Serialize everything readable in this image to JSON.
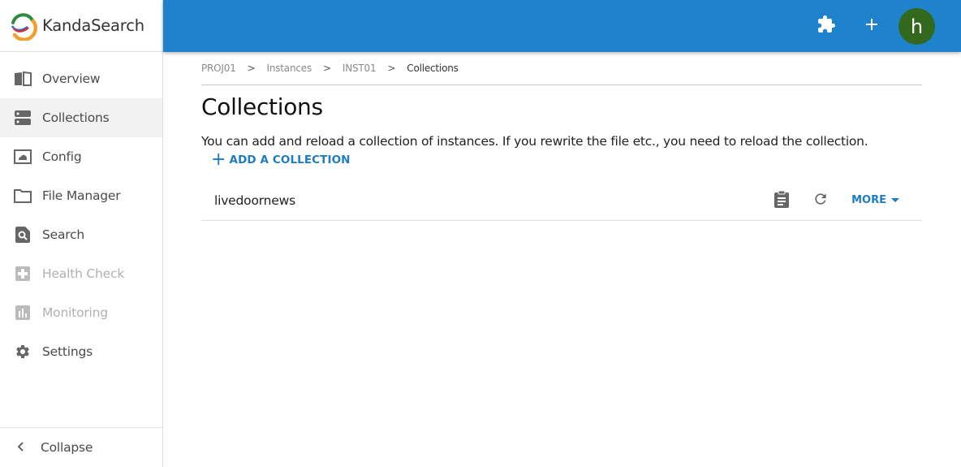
{
  "app": {
    "name": "KandaSearch"
  },
  "sidebar": {
    "items": [
      {
        "label": "Overview",
        "icon": "book-open-icon",
        "state": "normal"
      },
      {
        "label": "Collections",
        "icon": "server-icon",
        "state": "active"
      },
      {
        "label": "Config",
        "icon": "cloud-box-icon",
        "state": "normal"
      },
      {
        "label": "File Manager",
        "icon": "folder-icon",
        "state": "normal"
      },
      {
        "label": "Search",
        "icon": "file-search-icon",
        "state": "normal"
      },
      {
        "label": "Health Check",
        "icon": "medical-plus-icon",
        "state": "disabled"
      },
      {
        "label": "Monitoring",
        "icon": "bar-chart-icon",
        "state": "disabled"
      },
      {
        "label": "Settings",
        "icon": "gear-icon",
        "state": "normal"
      }
    ],
    "collapse_label": "Collapse"
  },
  "topbar": {
    "color": "#1e83cc",
    "extensions_icon": "puzzle-icon",
    "add_icon": "plus-icon",
    "avatar_letter": "h",
    "avatar_color": "#33691e"
  },
  "breadcrumb": [
    "PROJ01",
    "Instances",
    "INST01",
    "Collections"
  ],
  "page": {
    "title": "Collections",
    "description": "You can add and reload a collection of instances. If you rewrite the file etc., you need to reload the collection.",
    "add_button": "ADD A COLLECTION"
  },
  "collections": [
    {
      "name": "livedoornews",
      "more_label": "MORE"
    }
  ]
}
